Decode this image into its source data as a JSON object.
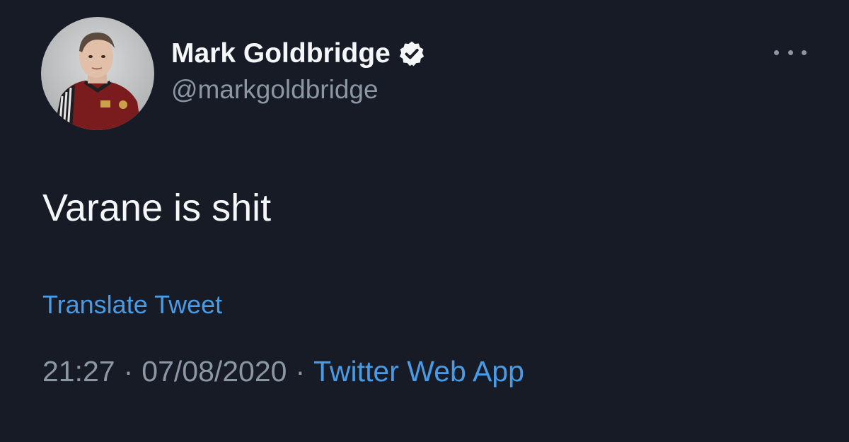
{
  "tweet": {
    "display_name": "Mark Goldbridge",
    "handle": "@markgoldbridge",
    "verified": true,
    "text": "Varane is shit",
    "translate_label": "Translate Tweet",
    "time": "21:27",
    "date": "07/08/2020",
    "separator": "·",
    "source": "Twitter Web App"
  },
  "icons": {
    "verified": "verified-badge-icon",
    "more": "more-options-icon"
  },
  "colors": {
    "background": "#161b26",
    "name": "#f5f6f7",
    "muted": "#8b97a3",
    "link": "#4a9be6"
  }
}
